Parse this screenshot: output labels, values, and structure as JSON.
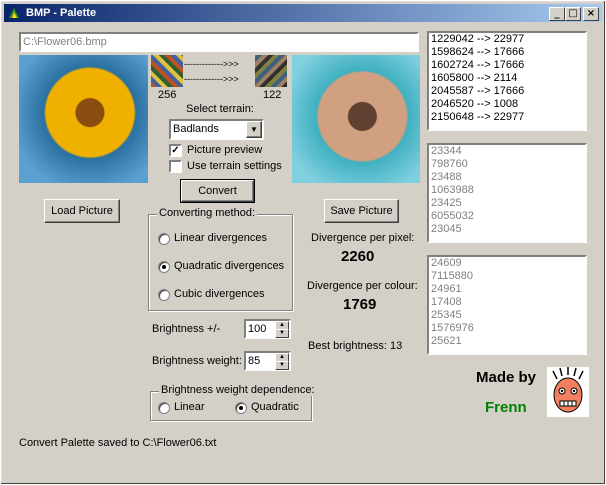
{
  "window": {
    "title": "BMP - Palette",
    "min_btn": "_",
    "max_btn": "□",
    "close_btn": "×"
  },
  "file_path": "C:\\Flower06.bmp",
  "palette": {
    "from_count": "256",
    "to_count": "122",
    "arrow": "------------->>>"
  },
  "terrain": {
    "label": "Select terrain:",
    "value": "Badlands"
  },
  "options": {
    "preview_label": "Picture preview",
    "preview_checked": true,
    "terrain_settings_label": "Use terrain settings",
    "terrain_settings_checked": false
  },
  "buttons": {
    "convert": "Convert",
    "load": "Load Picture",
    "save": "Save Picture"
  },
  "method": {
    "title": "Converting method:",
    "items": [
      "Linear divergences",
      "Quadratic divergences",
      "Cubic divergences"
    ],
    "selected": 1
  },
  "stats": {
    "per_pixel_label": "Divergence per pixel:",
    "per_pixel_value": "2260",
    "per_colour_label": "Divergence per colour:",
    "per_colour_value": "1769",
    "best_brightness_label": "Best brightness:",
    "best_brightness_value": "13"
  },
  "brightness": {
    "label": "Brightness +/-",
    "value": "100",
    "weight_label": "Brightness weight:",
    "weight_value": "85"
  },
  "dependence": {
    "title": "Brightness weight dependence:",
    "items": [
      "Linear",
      "Quadratic"
    ],
    "selected": 1
  },
  "credit": {
    "made_by": "Made by",
    "name": "Frenn",
    "name_color": "#008000"
  },
  "status": "Convert Palette saved to C:\\Flower06.txt",
  "lists": {
    "mapping": [
      "1229042 --> 22977",
      "1598624 --> 17666",
      "1602724 --> 17666",
      "1605800 --> 2114",
      "2045587 --> 17666",
      "2046520 --> 1008",
      "2150648 --> 22977"
    ],
    "list2": [
      "23344",
      "798760",
      "23488",
      "1063988",
      "23425",
      "6055032",
      "23045"
    ],
    "list3": [
      "24609",
      "7115880",
      "24961",
      "17408",
      "25345",
      "1576976",
      "25621"
    ]
  }
}
